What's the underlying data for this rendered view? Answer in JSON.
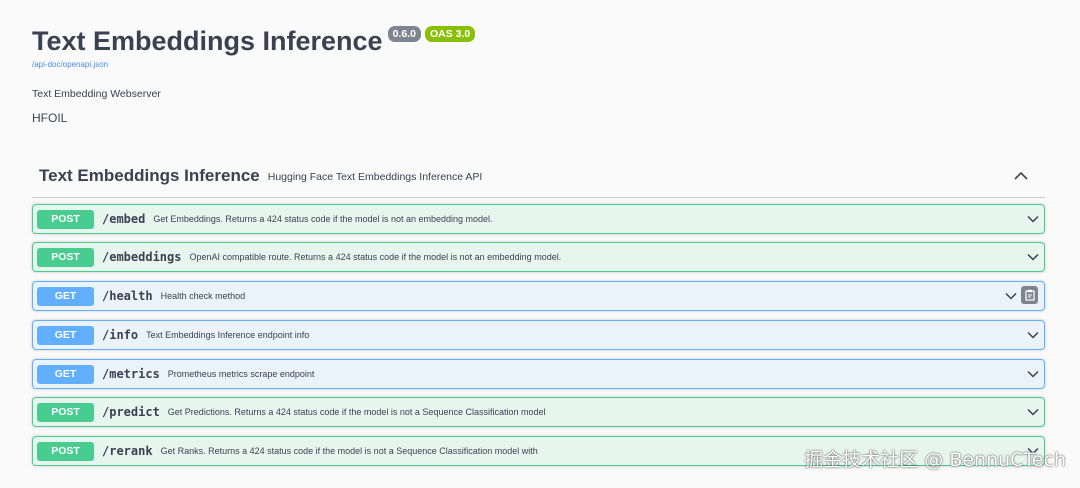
{
  "info": {
    "title": "Text Embeddings Inference",
    "version_badge": "0.6.0",
    "oas_badge": "OAS 3.0",
    "spec_link": "/api-doc/openapi.json",
    "description": "Text Embedding Webserver",
    "license": "HFOIL"
  },
  "section": {
    "title": "Text Embeddings Inference",
    "subtitle": "Hugging Face Text Embeddings Inference API",
    "toggle_icon": "chevron-up-icon"
  },
  "operations": [
    {
      "method": "POST",
      "path": "/embed",
      "summary": "Get Embeddings. Returns a 424 status code if the model is not an embedding model."
    },
    {
      "method": "POST",
      "path": "/embeddings",
      "summary": "OpenAI compatible route. Returns a 424 status code if the model is not an embedding model."
    },
    {
      "method": "GET",
      "path": "/health",
      "summary": "Health check method"
    },
    {
      "method": "GET",
      "path": "/info",
      "summary": "Text Embeddings Inference endpoint info"
    },
    {
      "method": "GET",
      "path": "/metrics",
      "summary": "Prometheus metrics scrape endpoint"
    },
    {
      "method": "POST",
      "path": "/predict",
      "summary": "Get Predictions. Returns a 424 status code if the model is not a Sequence Classification model"
    },
    {
      "method": "POST",
      "path": "/rerank",
      "summary": "Get Ranks. Returns a 424 status code if the model is not a Sequence Classification model with"
    }
  ],
  "watermark": "掘金技术社区 @ BennuCTech",
  "colors": {
    "post": "#49cc90",
    "get": "#61affe",
    "version_badge": "#7d8492",
    "oas_badge": "#89bf04",
    "link": "#4990e2"
  }
}
